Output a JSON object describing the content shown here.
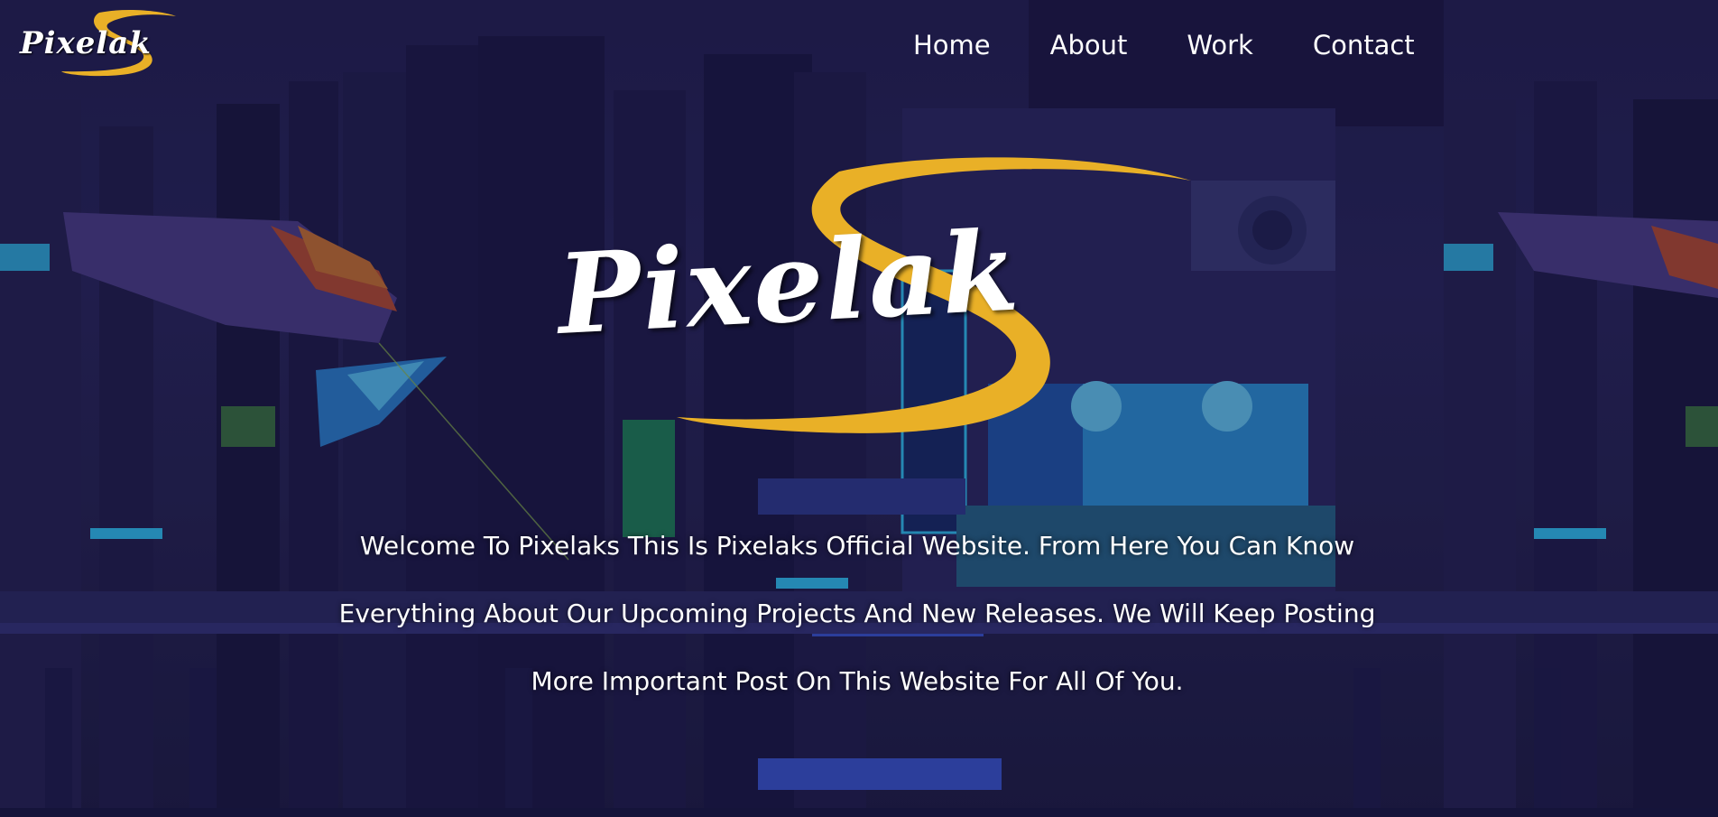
{
  "brand": {
    "name": "Pixelak",
    "accent_color": "#e9b027"
  },
  "nav": {
    "items": [
      {
        "label": "Home"
      },
      {
        "label": "About"
      },
      {
        "label": "Work"
      },
      {
        "label": "Contact"
      }
    ]
  },
  "hero": {
    "logo_text": "Pixelak",
    "welcome_lines": [
      "Welcome To Pixelaks This Is Pixelaks Official Website. From Here You Can Know",
      "Everything About Our Upcoming Projects And New Releases. We Will Keep Posting",
      "More Important Post On This Website For All Of You."
    ]
  },
  "background": {
    "base_color": "#221f4f",
    "neon_cyan": "#2fd1ff",
    "neon_purple": "#8a3fd0",
    "neon_orange": "#d9622a"
  }
}
